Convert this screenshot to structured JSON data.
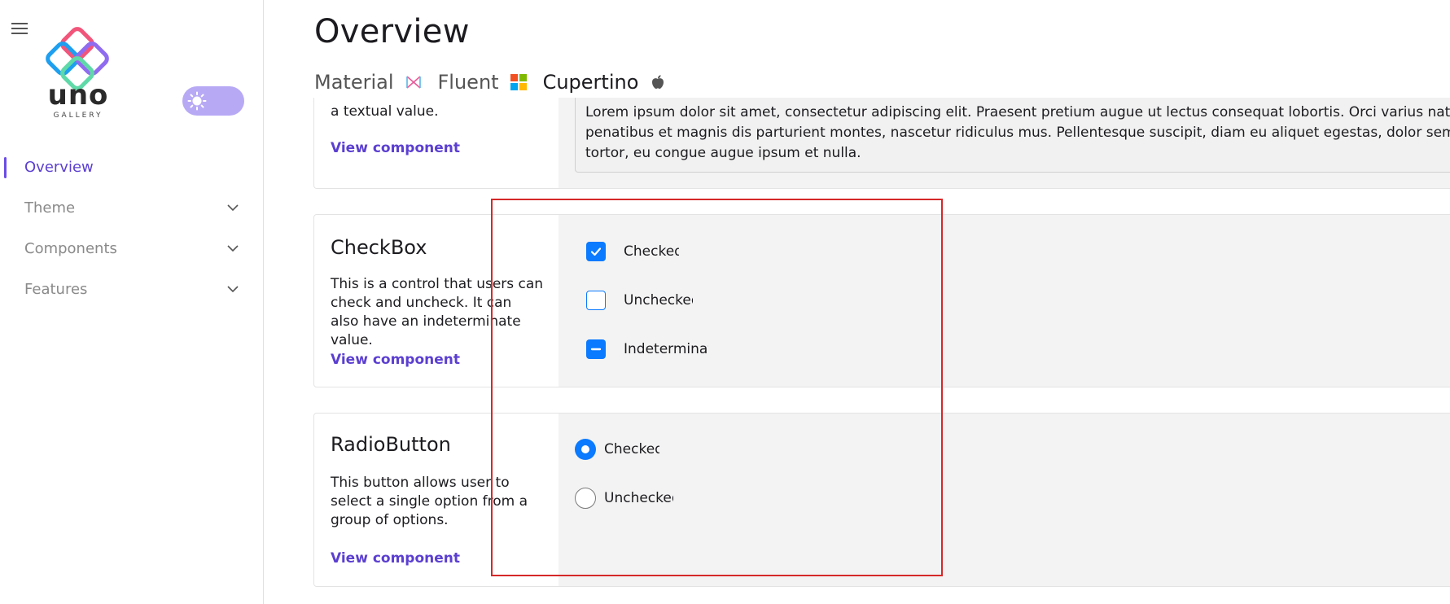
{
  "app": {
    "logo_word": "uno",
    "logo_sub": "GALLERY"
  },
  "sidebar": {
    "items": [
      {
        "label": "Overview",
        "active": true
      },
      {
        "label": "Theme",
        "expandable": true
      },
      {
        "label": "Components",
        "expandable": true
      },
      {
        "label": "Features",
        "expandable": true
      }
    ]
  },
  "main": {
    "title": "Overview",
    "tabs": [
      {
        "label": "Material",
        "icon": "material-icon"
      },
      {
        "label": "Fluent",
        "icon": "microsoft-icon"
      },
      {
        "label": "Cupertino",
        "icon": "apple-icon",
        "active": true
      }
    ]
  },
  "cards": {
    "text": {
      "desc_tail": "a textual value.",
      "link": "View component",
      "lorem_lines": [
        "Lorem ipsum dolor sit amet, consectetur adipiscing elit. Praesent pretium augue ut lectus consequat lobortis. Orci varius natoque",
        "penatibus et magnis dis parturient montes, nascetur ridiculus mus. Pellentesque suscipit, diam eu aliquet egestas, dolor sem matt",
        "tortor, eu congue augue ipsum et nulla."
      ]
    },
    "checkbox": {
      "title": "CheckBox",
      "desc": "This is a control that users can check and uncheck. It can also have an indeterminate value.",
      "link": "View component",
      "items": [
        {
          "label": "Checked",
          "state": "checked"
        },
        {
          "label": "Unchecked",
          "state": "unchecked"
        },
        {
          "label": "Indeterminate",
          "state": "indeterminate"
        }
      ]
    },
    "radiobutton": {
      "title": "RadioButton",
      "desc": "This button allows user to select a single option from a group of options.",
      "link": "View component",
      "items": [
        {
          "label": "Checked",
          "state": "checked"
        },
        {
          "label": "Unchecked",
          "state": "unchecked"
        }
      ]
    }
  },
  "colors": {
    "accent": "#6b4ce6",
    "link": "#5b3fd1",
    "cupertino_blue": "#0a7aff",
    "highlight": "#d62828"
  }
}
